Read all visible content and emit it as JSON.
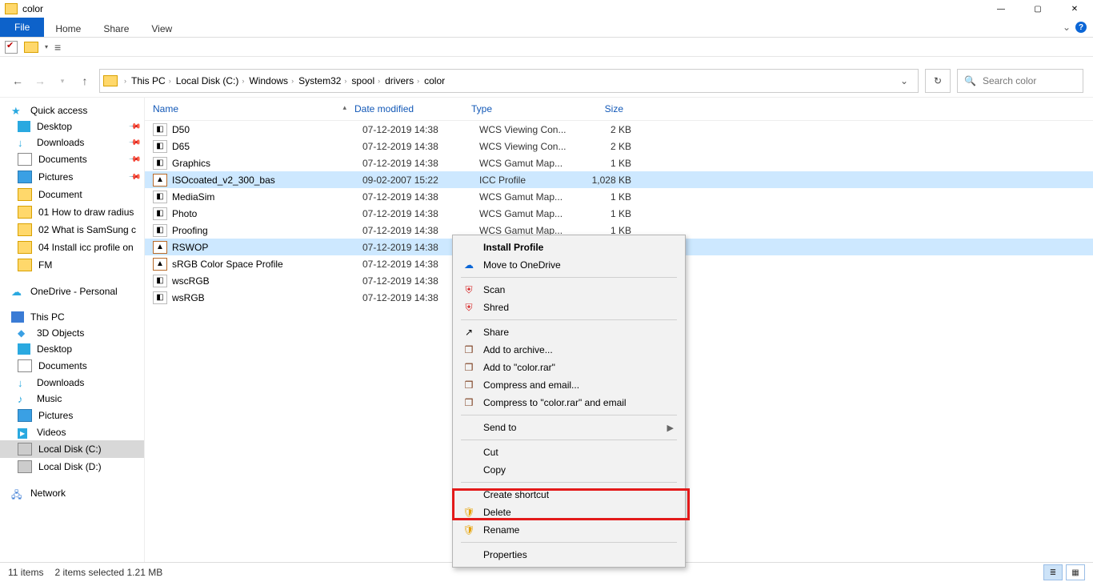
{
  "window": {
    "title": "color"
  },
  "ribbon": {
    "file": "File",
    "home": "Home",
    "share": "Share",
    "view": "View"
  },
  "breadcrumb": [
    "This PC",
    "Local Disk (C:)",
    "Windows",
    "System32",
    "spool",
    "drivers",
    "color"
  ],
  "search": {
    "placeholder": "Search color"
  },
  "columns": {
    "name": "Name",
    "date": "Date modified",
    "type": "Type",
    "size": "Size"
  },
  "sidebar": {
    "quick": "Quick access",
    "qitems": [
      "Desktop",
      "Downloads",
      "Documents",
      "Pictures",
      "Document",
      "01 How to draw radius",
      "02 What is SamSung c",
      "04 Install icc profile on",
      "FM"
    ],
    "onedrive": "OneDrive - Personal",
    "thispc": "This PC",
    "pcitems": [
      "3D Objects",
      "Desktop",
      "Documents",
      "Downloads",
      "Music",
      "Pictures",
      "Videos",
      "Local Disk (C:)",
      "Local Disk (D:)"
    ],
    "network": "Network"
  },
  "files": [
    {
      "name": "D50",
      "date": "07-12-2019 14:38",
      "type": "WCS Viewing Con...",
      "size": "2 KB",
      "sel": false,
      "icc": false
    },
    {
      "name": "D65",
      "date": "07-12-2019 14:38",
      "type": "WCS Viewing Con...",
      "size": "2 KB",
      "sel": false,
      "icc": false
    },
    {
      "name": "Graphics",
      "date": "07-12-2019 14:38",
      "type": "WCS Gamut Map...",
      "size": "1 KB",
      "sel": false,
      "icc": false
    },
    {
      "name": "ISOcoated_v2_300_bas",
      "date": "09-02-2007 15:22",
      "type": "ICC Profile",
      "size": "1,028 KB",
      "sel": true,
      "icc": true
    },
    {
      "name": "MediaSim",
      "date": "07-12-2019 14:38",
      "type": "WCS Gamut Map...",
      "size": "1 KB",
      "sel": false,
      "icc": false
    },
    {
      "name": "Photo",
      "date": "07-12-2019 14:38",
      "type": "WCS Gamut Map...",
      "size": "1 KB",
      "sel": false,
      "icc": false
    },
    {
      "name": "Proofing",
      "date": "07-12-2019 14:38",
      "type": "WCS Gamut Map...",
      "size": "1 KB",
      "sel": false,
      "icc": false
    },
    {
      "name": "RSWOP",
      "date": "07-12-2019 14:38",
      "type": "",
      "size": "",
      "sel": true,
      "icc": true
    },
    {
      "name": "sRGB Color Space Profile",
      "date": "07-12-2019 14:38",
      "type": "",
      "size": "",
      "sel": false,
      "icc": true
    },
    {
      "name": "wscRGB",
      "date": "07-12-2019 14:38",
      "type": "",
      "size": "",
      "sel": false,
      "icc": false
    },
    {
      "name": "wsRGB",
      "date": "07-12-2019 14:38",
      "type": "",
      "size": "",
      "sel": false,
      "icc": false
    }
  ],
  "context": {
    "install": "Install Profile",
    "onedrive": "Move to OneDrive",
    "scan": "Scan",
    "shred": "Shred",
    "share": "Share",
    "addarchive": "Add to archive...",
    "addcolor": "Add to \"color.rar\"",
    "compressemail": "Compress and email...",
    "compresscolor": "Compress to \"color.rar\" and email",
    "sendto": "Send to",
    "cut": "Cut",
    "copy": "Copy",
    "shortcut": "Create shortcut",
    "delete": "Delete",
    "rename": "Rename",
    "properties": "Properties"
  },
  "status": {
    "items": "11 items",
    "selected": "2 items selected  1.21 MB"
  }
}
